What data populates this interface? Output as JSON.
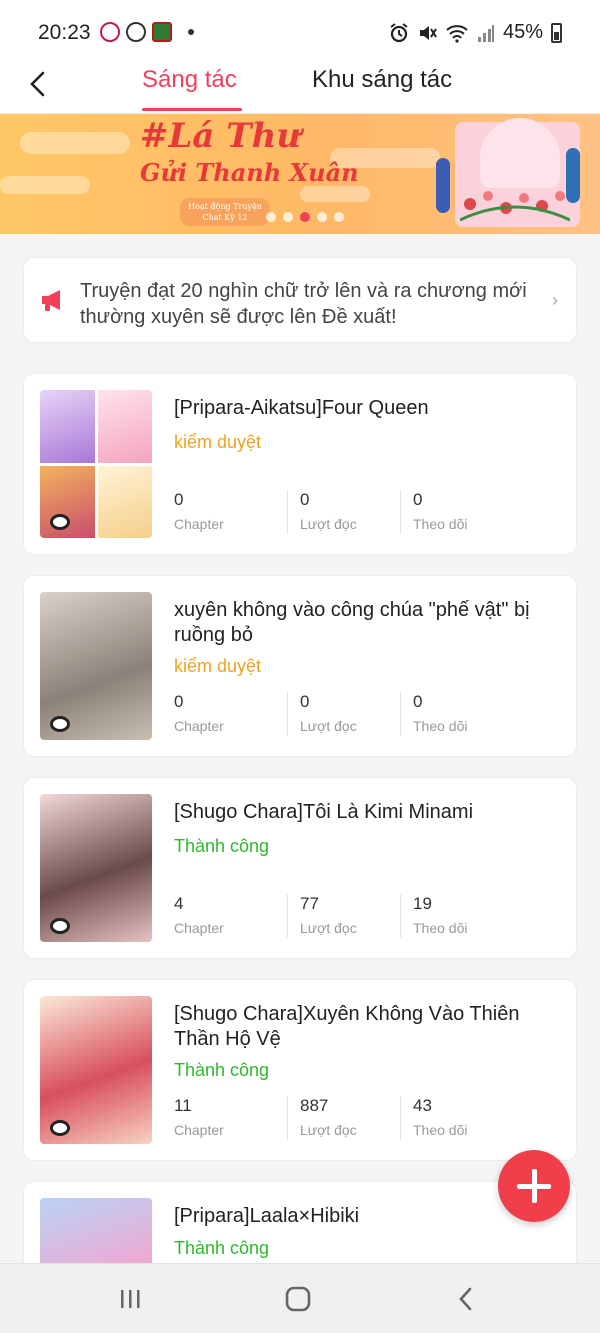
{
  "status_bar": {
    "time": "20:23",
    "battery": "45%",
    "icons": [
      "app-notification-icon",
      "broadcast-icon",
      "flag-app-icon",
      "alarm-icon",
      "mute-icon",
      "wifi-icon",
      "signal-icon",
      "battery-icon"
    ]
  },
  "header": {
    "back_icon": "chevron-left-icon",
    "tabs": [
      {
        "label": "Sáng tác",
        "active": true
      },
      {
        "label": "Khu sáng tác",
        "active": false
      }
    ]
  },
  "banner": {
    "title": "#Lá Thư",
    "subtitle": "Gửi Thanh Xuân",
    "tag": "Hoạt động Truyện Chat Kỳ 12",
    "slides": 5,
    "active_slide": 2
  },
  "notice": {
    "icon": "megaphone-icon",
    "text": "Truyện đạt 20 nghìn chữ trở lên và ra chương mới thường xuyên sẽ được lên Đề xuất!"
  },
  "stories": [
    {
      "title": "[Pripara-Aikatsu]Four Queen",
      "status": "kiểm duyệt",
      "status_color": "#f0a31c",
      "stats": [
        {
          "value": "0",
          "label": "Chapter"
        },
        {
          "value": "0",
          "label": "Lượt đọc"
        },
        {
          "value": "0",
          "label": "Theo dõi"
        }
      ]
    },
    {
      "title": "xuyên không vào công chúa \"phế vật\" bị ruồng bỏ",
      "status": "kiểm duyệt",
      "status_color": "#f0a31c",
      "stats": [
        {
          "value": "0",
          "label": "Chapter"
        },
        {
          "value": "0",
          "label": "Lượt đọc"
        },
        {
          "value": "0",
          "label": "Theo dõi"
        }
      ]
    },
    {
      "title": "[Shugo Chara]Tôi Là Kimi Minami",
      "status": "Thành công",
      "status_color": "#2eb82e",
      "stats": [
        {
          "value": "4",
          "label": "Chapter"
        },
        {
          "value": "77",
          "label": "Lượt đọc"
        },
        {
          "value": "19",
          "label": "Theo dõi"
        }
      ]
    },
    {
      "title": "[Shugo Chara]Xuyên Không Vào Thiên Thần Hộ Vệ",
      "status": "Thành công",
      "status_color": "#2eb82e",
      "stats": [
        {
          "value": "11",
          "label": "Chapter"
        },
        {
          "value": "887",
          "label": "Lượt đọc"
        },
        {
          "value": "43",
          "label": "Theo dõi"
        }
      ]
    },
    {
      "title": "[Pripara]Laala×Hibiki",
      "status": "Thành công",
      "status_color": "#2eb82e",
      "stats": []
    }
  ],
  "fab": {
    "icon": "plus-icon"
  },
  "system_nav": {
    "icons": [
      "recent-apps-icon",
      "home-icon",
      "back-icon"
    ]
  },
  "colors": {
    "accent": "#f0405a",
    "review": "#f0a31c",
    "success": "#2eb82e"
  }
}
